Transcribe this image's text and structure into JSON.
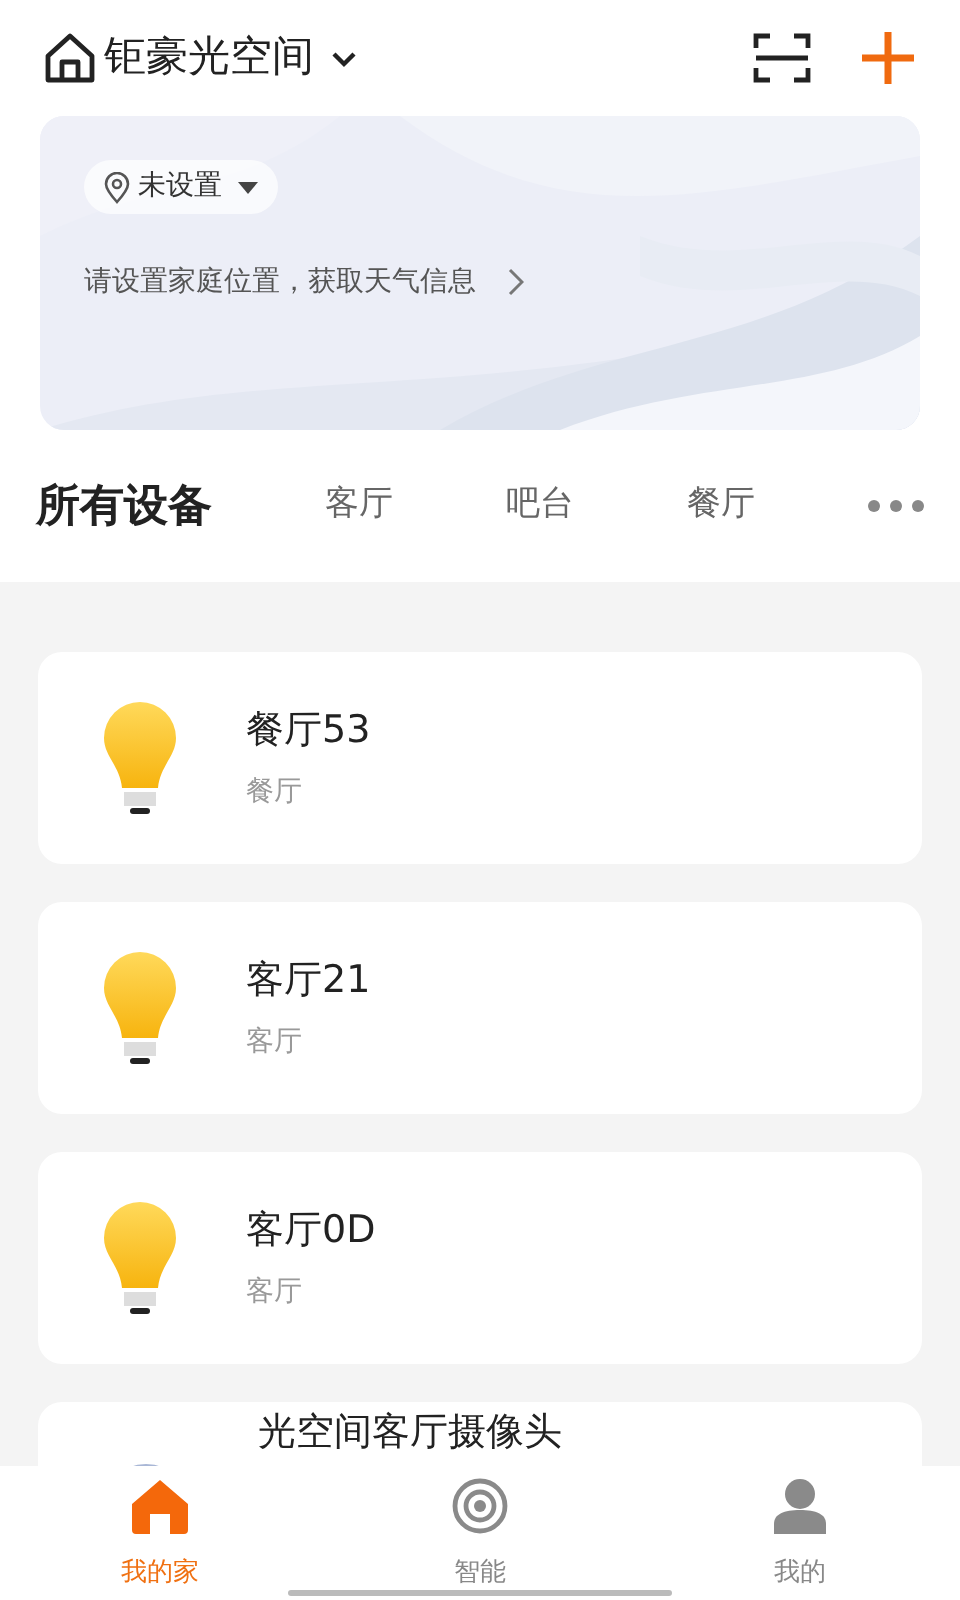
{
  "header": {
    "home_name": "钜豪光空间"
  },
  "weather_card": {
    "location": "未设置",
    "prompt": "请设置家庭位置，获取天气信息"
  },
  "room_tabs": [
    {
      "label": "所有设备",
      "selected": true
    },
    {
      "label": "客厅",
      "selected": false
    },
    {
      "label": "吧台",
      "selected": false
    },
    {
      "label": "餐厅",
      "selected": false
    }
  ],
  "devices": [
    {
      "kind": "bulb",
      "name": "餐厅53",
      "room": "餐厅"
    },
    {
      "kind": "bulb",
      "name": "客厅21",
      "room": "客厅"
    },
    {
      "kind": "bulb",
      "name": "客厅0D",
      "room": "客厅"
    },
    {
      "kind": "camera",
      "name": "光空间客厅摄像头"
    }
  ],
  "bottom_nav": [
    {
      "kind": "home",
      "label": "我的家",
      "selected": true
    },
    {
      "kind": "smart",
      "label": "智能",
      "selected": false
    },
    {
      "kind": "me",
      "label": "我的",
      "selected": false
    }
  ]
}
